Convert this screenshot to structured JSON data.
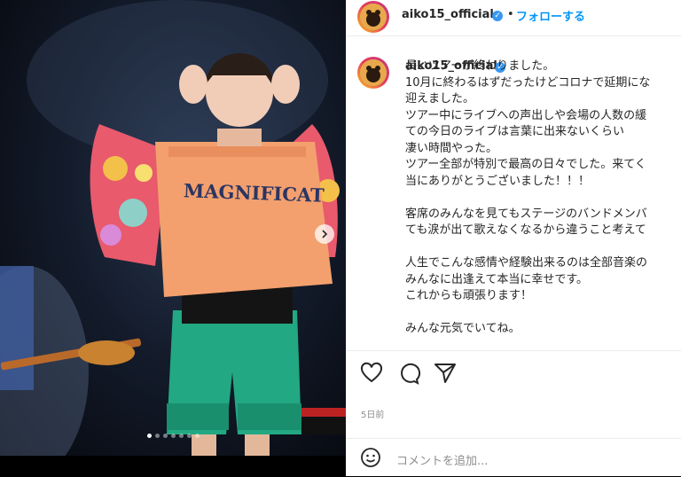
{
  "post": {
    "username": "aiko15_official",
    "follow_label": "フォローする",
    "separator": "•",
    "caption_lines": [
      "長いツアーが終わりました。",
      "10月に終わるはずだったけどコロナで延期にな",
      "迎えました。",
      "ツアー中にライブへの声出しや会場の人数の緩",
      "ての今日のライブは言葉に出来ないくらい",
      "凄い時間やった。",
      "ツアー全部が特別で最高の日々でした。来てく",
      "当にありがとうございました！！！",
      "",
      "客席のみんなを見てもステージのバンドメンバ",
      "ても涙が出て歌えなくなるから違うこと考えて",
      "",
      "人生でこんな感情や経験出来るのは全部音楽の",
      "みんなに出逢えて本当に幸せです。",
      "これからも頑張ります！",
      "",
      "みんな元気でいてね。"
    ],
    "date": "5日前",
    "comment_placeholder": "コメントを追加...",
    "shirt_text": "MAGNIFICAT",
    "carousel": {
      "total": 7,
      "active": 1
    },
    "colors": {
      "accent": "#0095f6",
      "verified": "#3897f0"
    }
  }
}
